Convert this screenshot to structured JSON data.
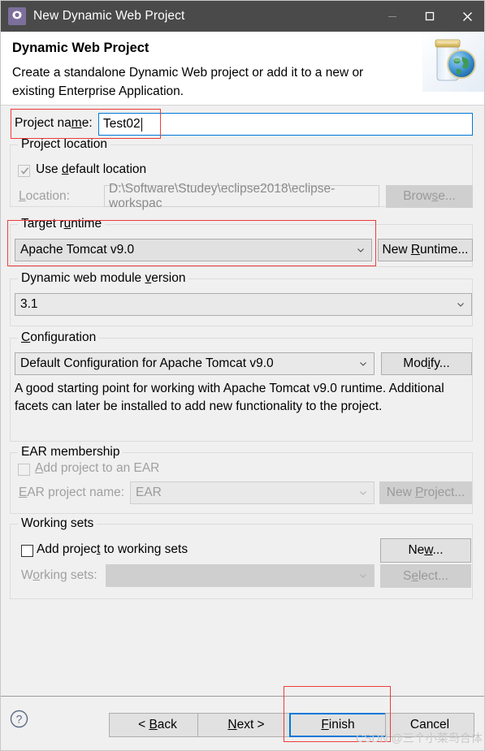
{
  "window": {
    "title": "New Dynamic Web Project",
    "icon": "eclipse-wizard-icon",
    "buttons": {
      "minimize": "—",
      "maximize": "☐",
      "close": "✕"
    }
  },
  "banner": {
    "title": "Dynamic Web Project",
    "description": "Create a standalone Dynamic Web project or add it to a new or existing Enterprise Application.",
    "image": "jar-with-globe-icon"
  },
  "project_name": {
    "label": "Project name:",
    "label_prefix": "Project na",
    "label_mnemonic": "m",
    "label_suffix": "e:",
    "value": "Test02",
    "placeholder": ""
  },
  "project_location": {
    "group_title": "Project location",
    "use_default": {
      "label_prefix": "Use ",
      "label_mnemonic": "d",
      "label_suffix": "efault location",
      "checked": true,
      "enabled": false
    },
    "location": {
      "label_mnemonic": "L",
      "label_suffix": "ocation:",
      "value": "D:\\Software\\Studey\\eclipse2018\\eclipse-workspac",
      "enabled": false
    },
    "browse_button": {
      "label_prefix": "Brow",
      "label_mnemonic": "s",
      "label_suffix": "e...",
      "enabled": false
    }
  },
  "target_runtime": {
    "group_title_prefix": "Target r",
    "group_title_mnemonic": "u",
    "group_title_suffix": "ntime",
    "selected": "Apache Tomcat v9.0",
    "new_runtime_button": {
      "label_prefix": "New ",
      "label_mnemonic": "R",
      "label_suffix": "untime..."
    }
  },
  "web_module_version": {
    "group_title_prefix": "Dynamic web module ",
    "group_title_mnemonic": "v",
    "group_title_suffix": "ersion",
    "selected": "3.1"
  },
  "configuration": {
    "group_title_mnemonic": "C",
    "group_title_suffix": "onfiguration",
    "selected": "Default Configuration for Apache Tomcat v9.0",
    "modify_button": {
      "label_prefix": "Mod",
      "label_mnemonic": "i",
      "label_suffix": "fy..."
    },
    "description": "A good starting point for working with Apache Tomcat v9.0 runtime. Additional facets can later be installed to add new functionality to the project."
  },
  "ear_membership": {
    "group_title": "EAR membership",
    "add_to_ear": {
      "label_mnemonic": "A",
      "label_suffix": "dd project to an EAR",
      "checked": false,
      "enabled": false
    },
    "ear_project_name": {
      "label_mnemonic": "E",
      "label_suffix": "AR project name:",
      "value": "EAR",
      "enabled": false
    },
    "new_project_button": {
      "label_prefix": "New ",
      "label_mnemonic": "P",
      "label_suffix": "roject...",
      "enabled": false
    }
  },
  "working_sets": {
    "group_title": "Working sets",
    "add_to_working_sets": {
      "label_prefix": "Add projec",
      "label_mnemonic": "t",
      "label_suffix": " to working sets",
      "checked": false,
      "enabled": true
    },
    "new_button": {
      "label_prefix": "Ne",
      "label_mnemonic": "w",
      "label_suffix": "..."
    },
    "working_sets_combo": {
      "label_prefix": "W",
      "label_mnemonic": "o",
      "label_suffix": "rking sets:",
      "value": "",
      "enabled": false
    },
    "select_button": {
      "label_prefix": "S",
      "label_mnemonic": "e",
      "label_suffix": "lect...",
      "enabled": false
    }
  },
  "footer": {
    "help_icon": "help-question-icon",
    "back_button": {
      "label_prefix": "< ",
      "label_mnemonic": "B",
      "label_suffix": "ack"
    },
    "next_button": {
      "label_mnemonic": "N",
      "label_suffix": "ext >"
    },
    "finish_button": {
      "label_prefix": "",
      "label_mnemonic": "F",
      "label_suffix": "inish",
      "focused": true
    },
    "cancel_button": {
      "label": "Cancel"
    }
  },
  "watermark": {
    "text": "CSDN @三个小菜鸟合体"
  },
  "colors": {
    "titlebar_bg": "#4a4a4a",
    "dialog_bg": "#f0f0f0",
    "accent_focus": "#0078d7",
    "annotation_red": "#ef3b3b",
    "icon_purple": "#7d6f9c"
  }
}
